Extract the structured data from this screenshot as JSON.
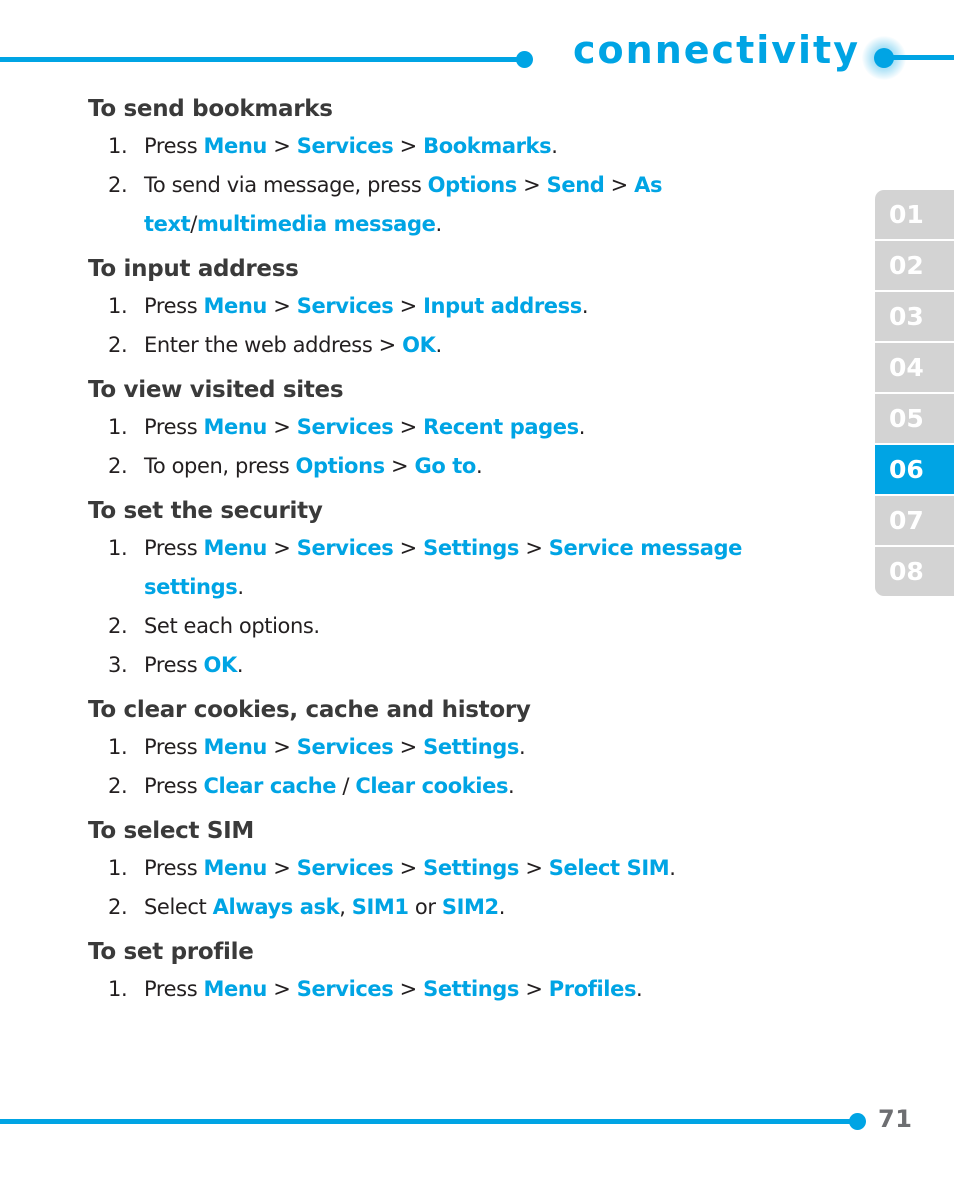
{
  "header": {
    "title": "connectivity",
    "accent_color": "#00A4E4"
  },
  "sidebar": {
    "tabs": [
      {
        "label": "01",
        "active": false
      },
      {
        "label": "02",
        "active": false
      },
      {
        "label": "03",
        "active": false
      },
      {
        "label": "04",
        "active": false
      },
      {
        "label": "05",
        "active": false
      },
      {
        "label": "06",
        "active": true
      },
      {
        "label": "07",
        "active": false
      },
      {
        "label": "08",
        "active": false
      }
    ],
    "active_color": "#00A4E4",
    "inactive_color": "#d3d3d3"
  },
  "footer": {
    "page_number": "71"
  },
  "sections": [
    {
      "title": "To send bookmarks",
      "steps": [
        {
          "number": "1.",
          "parts": [
            {
              "t": "Press ",
              "s": "plain"
            },
            {
              "t": "Menu",
              "s": "key"
            },
            {
              "t": " > ",
              "s": "plain"
            },
            {
              "t": "Services",
              "s": "key"
            },
            {
              "t": " > ",
              "s": "plain"
            },
            {
              "t": "Bookmarks",
              "s": "key"
            },
            {
              "t": ".",
              "s": "plain"
            }
          ]
        },
        {
          "number": "2.",
          "parts": [
            {
              "t": "To send via message, press ",
              "s": "plain"
            },
            {
              "t": "Options",
              "s": "key"
            },
            {
              "t": " > ",
              "s": "plain"
            },
            {
              "t": "Send",
              "s": "key"
            },
            {
              "t": " > ",
              "s": "plain"
            },
            {
              "t": "As text",
              "s": "key"
            },
            {
              "t": "/",
              "s": "plain"
            },
            {
              "t": "multimedia message",
              "s": "key"
            },
            {
              "t": ".",
              "s": "plain"
            }
          ]
        }
      ]
    },
    {
      "title": "To input address",
      "steps": [
        {
          "number": "1.",
          "parts": [
            {
              "t": "Press ",
              "s": "plain"
            },
            {
              "t": "Menu",
              "s": "key"
            },
            {
              "t": " > ",
              "s": "plain"
            },
            {
              "t": "Services",
              "s": "key"
            },
            {
              "t": " > ",
              "s": "plain"
            },
            {
              "t": "Input address",
              "s": "key"
            },
            {
              "t": ".",
              "s": "plain"
            }
          ]
        },
        {
          "number": "2.",
          "parts": [
            {
              "t": "Enter the web address > ",
              "s": "plain"
            },
            {
              "t": "OK",
              "s": "key"
            },
            {
              "t": ".",
              "s": "plain"
            }
          ]
        }
      ]
    },
    {
      "title": "To view visited sites",
      "steps": [
        {
          "number": "1.",
          "parts": [
            {
              "t": "Press ",
              "s": "plain"
            },
            {
              "t": "Menu",
              "s": "key"
            },
            {
              "t": " > ",
              "s": "plain"
            },
            {
              "t": "Services",
              "s": "key"
            },
            {
              "t": " > ",
              "s": "plain"
            },
            {
              "t": "Recent pages",
              "s": "key"
            },
            {
              "t": ".",
              "s": "plain"
            }
          ]
        },
        {
          "number": "2.",
          "parts": [
            {
              "t": "To open, press ",
              "s": "plain"
            },
            {
              "t": "Options",
              "s": "key"
            },
            {
              "t": " > ",
              "s": "plain"
            },
            {
              "t": "Go to",
              "s": "key"
            },
            {
              "t": ".",
              "s": "plain"
            }
          ]
        }
      ]
    },
    {
      "title": "To set the security",
      "steps": [
        {
          "number": "1.",
          "parts": [
            {
              "t": "Press ",
              "s": "plain"
            },
            {
              "t": "Menu",
              "s": "key"
            },
            {
              "t": " > ",
              "s": "plain"
            },
            {
              "t": "Services",
              "s": "key"
            },
            {
              "t": " > ",
              "s": "plain"
            },
            {
              "t": "Settings",
              "s": "key"
            },
            {
              "t": " > ",
              "s": "plain"
            },
            {
              "t": "Service message settings",
              "s": "key"
            },
            {
              "t": ".",
              "s": "plain"
            }
          ]
        },
        {
          "number": "2.",
          "parts": [
            {
              "t": "Set each options.",
              "s": "plain"
            }
          ]
        },
        {
          "number": "3.",
          "parts": [
            {
              "t": "Press ",
              "s": "plain"
            },
            {
              "t": "OK",
              "s": "key"
            },
            {
              "t": ".",
              "s": "plain"
            }
          ]
        }
      ]
    },
    {
      "title": "To clear cookies, cache and history",
      "steps": [
        {
          "number": "1.",
          "parts": [
            {
              "t": "Press ",
              "s": "plain"
            },
            {
              "t": "Menu",
              "s": "key"
            },
            {
              "t": " > ",
              "s": "plain"
            },
            {
              "t": "Services",
              "s": "key"
            },
            {
              "t": " > ",
              "s": "plain"
            },
            {
              "t": "Settings",
              "s": "key"
            },
            {
              "t": ".",
              "s": "plain"
            }
          ]
        },
        {
          "number": "2.",
          "parts": [
            {
              "t": "Press ",
              "s": "plain"
            },
            {
              "t": "Clear cache",
              "s": "key"
            },
            {
              "t": " / ",
              "s": "plain"
            },
            {
              "t": "Clear cookies",
              "s": "key"
            },
            {
              "t": ".",
              "s": "plain"
            }
          ]
        }
      ]
    },
    {
      "title": "To select SIM",
      "steps": [
        {
          "number": "1.",
          "parts": [
            {
              "t": "Press ",
              "s": "plain"
            },
            {
              "t": "Menu",
              "s": "key"
            },
            {
              "t": " > ",
              "s": "plain"
            },
            {
              "t": "Services",
              "s": "key"
            },
            {
              "t": " > ",
              "s": "plain"
            },
            {
              "t": "Settings",
              "s": "key"
            },
            {
              "t": " > ",
              "s": "plain"
            },
            {
              "t": "Select SIM",
              "s": "key"
            },
            {
              "t": ".",
              "s": "plain"
            }
          ]
        },
        {
          "number": "2.",
          "parts": [
            {
              "t": "Select ",
              "s": "plain"
            },
            {
              "t": "Always ask",
              "s": "key"
            },
            {
              "t": ", ",
              "s": "plain"
            },
            {
              "t": "SIM1",
              "s": "key"
            },
            {
              "t": " or ",
              "s": "plain"
            },
            {
              "t": "SIM2",
              "s": "key"
            },
            {
              "t": ".",
              "s": "plain"
            }
          ]
        }
      ]
    },
    {
      "title": "To set profile",
      "steps": [
        {
          "number": "1.",
          "parts": [
            {
              "t": "Press ",
              "s": "plain"
            },
            {
              "t": "Menu",
              "s": "key"
            },
            {
              "t": " > ",
              "s": "plain"
            },
            {
              "t": "Services",
              "s": "key"
            },
            {
              "t": " > ",
              "s": "plain"
            },
            {
              "t": "Settings",
              "s": "key"
            },
            {
              "t": " > ",
              "s": "plain"
            },
            {
              "t": "Profiles",
              "s": "key"
            },
            {
              "t": ".",
              "s": "plain"
            }
          ]
        }
      ]
    }
  ]
}
